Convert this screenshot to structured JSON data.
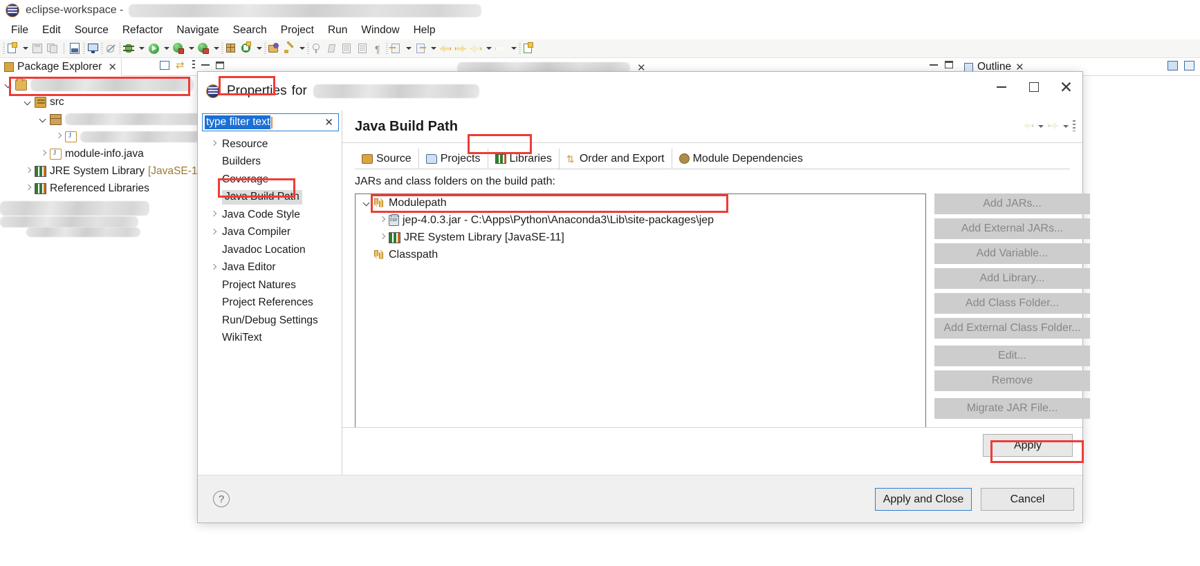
{
  "window": {
    "title": "eclipse-workspace -",
    "logo_icon": "eclipse-logo-icon",
    "menu": [
      "File",
      "Edit",
      "Source",
      "Refactor",
      "Navigate",
      "Search",
      "Project",
      "Run",
      "Window",
      "Help"
    ]
  },
  "package_explorer": {
    "tab_label": "Package Explorer",
    "close_icon": "close-icon",
    "view_icons": [
      "collapse-all-icon",
      "link-with-editor-icon",
      "view-menu-icon",
      "minimize-icon",
      "maximize-icon"
    ],
    "tree": [
      {
        "label": "",
        "redacted": true,
        "icon": "project-icon",
        "indent": 0,
        "arrow": "down",
        "highlighted": true
      },
      {
        "label": "src",
        "redacted": false,
        "icon": "source-folder-icon",
        "indent": 1,
        "arrow": "down",
        "highlighted": false
      },
      {
        "label": "",
        "redacted": true,
        "icon": "package-icon",
        "indent": 2,
        "arrow": "down",
        "highlighted": false
      },
      {
        "label": "",
        "redacted": true,
        "icon": "java-file-icon",
        "indent": 3,
        "arrow": "right",
        "highlighted": false
      },
      {
        "label": "module-info.java",
        "redacted": false,
        "icon": "java-file-icon",
        "indent": 2,
        "arrow": "right",
        "highlighted": false
      },
      {
        "label": "JRE System Library",
        "suffix": "[JavaSE-11]",
        "redacted": false,
        "icon": "library-icon",
        "indent": 1,
        "arrow": "right",
        "highlighted": false
      },
      {
        "label": "Referenced Libraries",
        "redacted": false,
        "icon": "library-icon",
        "indent": 1,
        "arrow": "right",
        "highlighted": false
      }
    ]
  },
  "outline": {
    "tab_label": "Outline",
    "close_icon": "close-icon",
    "view_icons": [
      "sort-icon",
      "filter-icon"
    ]
  },
  "dialog": {
    "logo_icon": "eclipse-logo-icon",
    "title_prefix": "Properties",
    "title_middle": "for",
    "title_suffix_redacted": true,
    "minimize_icon": "minimize-icon",
    "maximize_icon": "maximize-icon",
    "close_icon": "close-icon",
    "filter": {
      "value": "type filter text",
      "placeholder": "type filter text",
      "clear_icon": "clear-icon"
    },
    "nav_items": [
      {
        "label": "Resource",
        "expandable": true,
        "selected": false
      },
      {
        "label": "Builders",
        "expandable": false,
        "selected": false
      },
      {
        "label": "Coverage",
        "expandable": false,
        "selected": false
      },
      {
        "label": "Java Build Path",
        "expandable": false,
        "selected": true
      },
      {
        "label": "Java Code Style",
        "expandable": true,
        "selected": false
      },
      {
        "label": "Java Compiler",
        "expandable": true,
        "selected": false
      },
      {
        "label": "Javadoc Location",
        "expandable": false,
        "selected": false
      },
      {
        "label": "Java Editor",
        "expandable": true,
        "selected": false
      },
      {
        "label": "Project Natures",
        "expandable": false,
        "selected": false
      },
      {
        "label": "Project References",
        "expandable": false,
        "selected": false
      },
      {
        "label": "Run/Debug Settings",
        "expandable": false,
        "selected": false
      },
      {
        "label": "WikiText",
        "expandable": false,
        "selected": false
      }
    ],
    "page": {
      "title": "Java Build Path",
      "nav_icons": [
        "back-icon",
        "back-dropdown-icon",
        "forward-icon",
        "forward-dropdown-icon",
        "view-menu-icon"
      ],
      "tabs": [
        {
          "label": "Source",
          "icon": "source-folder-icon",
          "selected": false
        },
        {
          "label": "Projects",
          "icon": "projects-icon",
          "selected": false
        },
        {
          "label": "Libraries",
          "icon": "library-icon",
          "selected": true
        },
        {
          "label": "Order and Export",
          "icon": "order-export-icon",
          "selected": false
        },
        {
          "label": "Module Dependencies",
          "icon": "module-icon",
          "selected": false
        }
      ],
      "list_label": "JARs and class folders on the build path:",
      "tree": [
        {
          "label": "Modulepath",
          "icon": "modulepath-icon",
          "indent": 0,
          "arrow": "down",
          "highlighted": false
        },
        {
          "label": "jep-4.0.3.jar - C:\\Apps\\Python\\Anaconda3\\Lib\\site-packages\\jep",
          "icon": "jar-icon",
          "indent": 1,
          "arrow": "right",
          "highlighted": true
        },
        {
          "label": "JRE System Library [JavaSE-11]",
          "icon": "library-icon",
          "indent": 1,
          "arrow": "right",
          "highlighted": false
        },
        {
          "label": "Classpath",
          "icon": "classpath-icon",
          "indent": 0,
          "arrow": "none",
          "highlighted": false
        }
      ],
      "buttons": [
        {
          "label": "Add JARs...",
          "enabled": false,
          "gap": false
        },
        {
          "label": "Add External JARs...",
          "enabled": false,
          "gap": false
        },
        {
          "label": "Add Variable...",
          "enabled": false,
          "gap": false
        },
        {
          "label": "Add Library...",
          "enabled": false,
          "gap": false
        },
        {
          "label": "Add Class Folder...",
          "enabled": false,
          "gap": false
        },
        {
          "label": "Add External Class Folder...",
          "enabled": false,
          "gap": false
        },
        {
          "label": "Edit...",
          "enabled": false,
          "gap": true
        },
        {
          "label": "Remove",
          "enabled": false,
          "gap": false
        },
        {
          "label": "Migrate JAR File...",
          "enabled": false,
          "gap": true
        }
      ],
      "apply_label": "Apply"
    },
    "footer": {
      "help_icon": "help-icon",
      "apply_and_close_label": "Apply and Close",
      "cancel_label": "Cancel"
    }
  },
  "annotation_color": "#ef3b36"
}
